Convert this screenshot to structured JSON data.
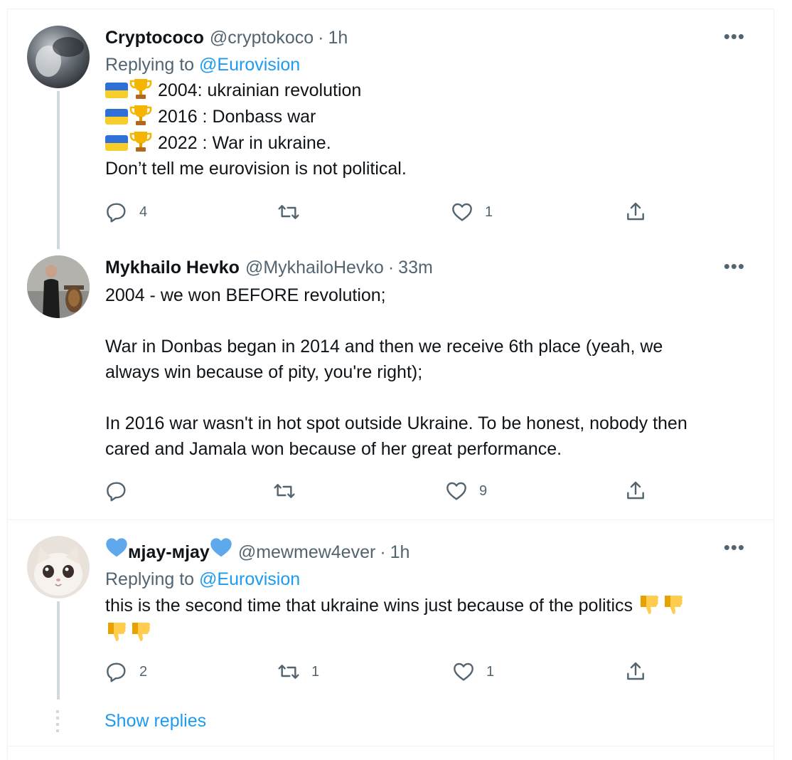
{
  "tweets": [
    {
      "name": "Cryptococo",
      "handle": "@cryptokoco",
      "time": "1h",
      "reply_prefix": "Replying to ",
      "reply_to": "@Eurovision",
      "lines": [
        "2004: ukrainian revolution",
        "2016 : Donbass war",
        "2022 : War in ukraine.",
        "Don’t tell me eurovision is not political."
      ],
      "reply_count": "4",
      "retweet_count": "",
      "like_count": "1"
    },
    {
      "name": "Mykhailo Hevko",
      "handle": "@MykhailoHevko",
      "time": "33m",
      "lines": [
        "2004 - we won BEFORE revolution;",
        "",
        "War in Donbas began in 2014 and then we receive 6th place (yeah, we",
        "always win because of pity, you're right);",
        "",
        "In 2016 war wasn't in hot spot outside Ukraine. To be honest, nobody then",
        "cared and Jamala won because of her great performance."
      ],
      "reply_count": "",
      "retweet_count": "",
      "like_count": "9"
    },
    {
      "name": "мjay-мjay",
      "handle": "@mewmew4ever",
      "time": "1h",
      "reply_prefix": "Replying to ",
      "reply_to": "@Eurovision",
      "line1": "this is the second time that ukraine wins just because of the politics",
      "reply_count": "2",
      "retweet_count": "1",
      "like_count": "1"
    }
  ],
  "show_replies": "Show replies",
  "separator_dot": "·",
  "more_glyph": "•••",
  "colors": {
    "link": "#1d9bf0",
    "muted": "#536471",
    "heart_emoji": "#5ea8ec"
  },
  "icons": [
    "reply-icon",
    "retweet-icon",
    "like-icon",
    "share-icon",
    "more-icon",
    "ukraine-flag-icon",
    "trophy-icon",
    "thumbs-down-icon",
    "blue-heart-icon"
  ]
}
